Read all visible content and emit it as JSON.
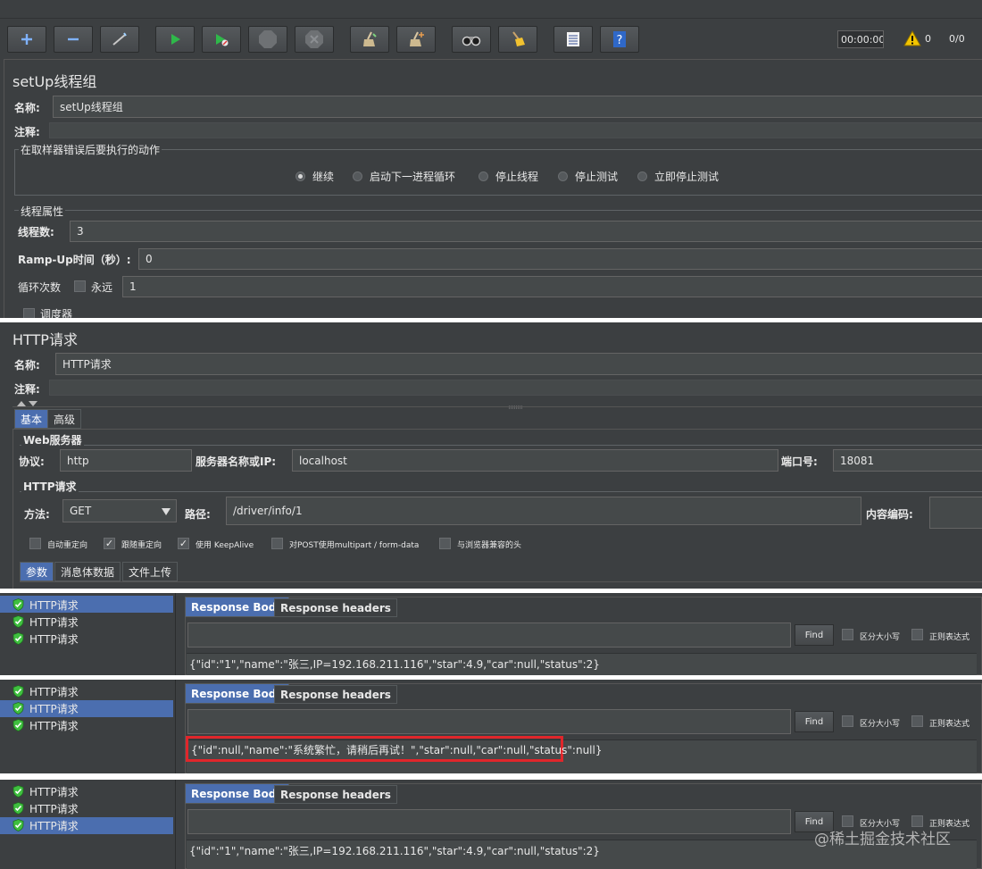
{
  "toolbar": {
    "buttons": [
      {
        "name": "add-button",
        "icon": "plus-icon"
      },
      {
        "name": "remove-button",
        "icon": "minus-icon"
      },
      {
        "name": "toggle-button",
        "icon": "wand-icon"
      },
      {
        "name": "start-button",
        "icon": "play-icon"
      },
      {
        "name": "start-no-pause-button",
        "icon": "play-no-timer-icon"
      },
      {
        "name": "stop-button",
        "icon": "stop-icon"
      },
      {
        "name": "shutdown-button",
        "icon": "shutdown-icon"
      },
      {
        "name": "clear-button",
        "icon": "broom-icon"
      },
      {
        "name": "clear-all-button",
        "icon": "broom-all-icon"
      },
      {
        "name": "search-button",
        "icon": "binoculars-icon"
      },
      {
        "name": "reset-search-button",
        "icon": "eraser-icon"
      },
      {
        "name": "function-helper-button",
        "icon": "list-icon"
      },
      {
        "name": "help-button",
        "icon": "help-book-icon"
      }
    ],
    "timer": "00:00:00",
    "warnings": "0",
    "threads": "0/0"
  },
  "setup": {
    "title": "setUp线程组",
    "name_label": "名称:",
    "name_value": "setUp线程组",
    "comment_label": "注释:",
    "error_group_title": "在取样器错误后要执行的动作",
    "actions": [
      "继续",
      "启动下一进程循环",
      "停止线程",
      "停止测试",
      "立即停止测试"
    ],
    "selected_action": "继续",
    "props_title": "线程属性",
    "threads_label": "线程数:",
    "threads_value": "3",
    "rampup_label": "Ramp-Up时间（秒）:",
    "rampup_value": "0",
    "loop_label": "循环次数",
    "forever_label": "永远",
    "loop_value": "1",
    "scheduler_label": "调度器"
  },
  "http": {
    "title": "HTTP请求",
    "name_label": "名称:",
    "name_value": "HTTP请求",
    "comment_label": "注释:",
    "tabs": [
      "基本",
      "高级"
    ],
    "web_server_title": "Web服务器",
    "protocol_label": "协议:",
    "protocol_value": "http",
    "server_label": "服务器名称或IP:",
    "server_value": "localhost",
    "port_label": "端口号:",
    "port_value": "18081",
    "request_title": "HTTP请求",
    "method_label": "方法:",
    "method_value": "GET",
    "path_label": "路径:",
    "path_value": "/driver/info/1",
    "encoding_label": "内容编码:",
    "options": [
      {
        "label": "自动重定向",
        "checked": false
      },
      {
        "label": "跟随重定向",
        "checked": true
      },
      {
        "label": "使用 KeepAlive",
        "checked": true
      },
      {
        "label": "对POST使用multipart / form-data",
        "checked": false
      },
      {
        "label": "与浏览器兼容的头",
        "checked": false
      }
    ],
    "body_tabs": [
      "参数",
      "消息体数据",
      "文件上传"
    ]
  },
  "results": [
    {
      "items": [
        "HTTP请求",
        "HTTP请求",
        "HTTP请求"
      ],
      "selected": 0,
      "tabs": [
        "Response Body",
        "Response headers"
      ],
      "find_label": "Find",
      "case_label": "区分大小写",
      "regex_label": "正则表达式",
      "body": "{\"id\":\"1\",\"name\":\"张三,IP=192.168.211.116\",\"star\":4.9,\"car\":null,\"status\":2}"
    },
    {
      "items": [
        "HTTP请求",
        "HTTP请求",
        "HTTP请求"
      ],
      "selected": 1,
      "tabs": [
        "Response Body",
        "Response headers"
      ],
      "find_label": "Find",
      "case_label": "区分大小写",
      "regex_label": "正则表达式",
      "body": "{\"id\":null,\"name\":\"系统繁忙，请稍后再试！\",\"star\":null,\"car\":null,\"status\":null}"
    },
    {
      "items": [
        "HTTP请求",
        "HTTP请求",
        "HTTP请求"
      ],
      "selected": 2,
      "tabs": [
        "Response Body",
        "Response headers"
      ],
      "find_label": "Find",
      "case_label": "区分大小写",
      "regex_label": "正则表达式",
      "body": "{\"id\":\"1\",\"name\":\"张三,IP=192.168.211.116\",\"star\":4.9,\"car\":null,\"status\":2}"
    }
  ],
  "watermark": "@稀土掘金技术社区",
  "colors": {
    "background": "#3c3f41",
    "selection": "#4b6eaf",
    "highlight_box": "#e0262b",
    "shield": "#3fbf3f"
  }
}
